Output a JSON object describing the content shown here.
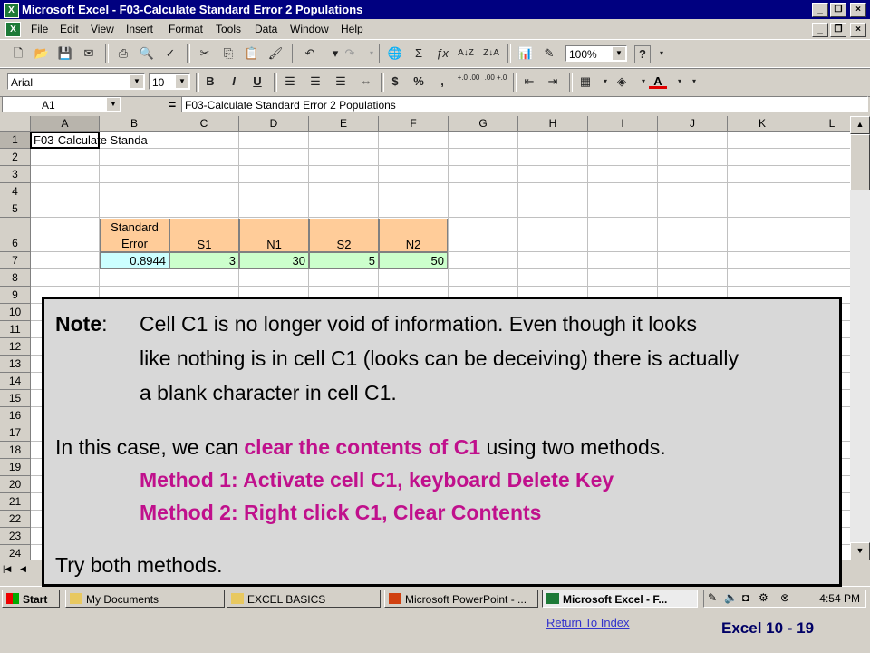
{
  "window": {
    "title": "Microsoft Excel - F03-Calculate Standard Error 2 Populations"
  },
  "menu": [
    "File",
    "Edit",
    "View",
    "Insert",
    "Format",
    "Tools",
    "Data",
    "Window",
    "Help"
  ],
  "toolbar": {
    "zoom": "100%",
    "help_icon": "?"
  },
  "format_toolbar": {
    "font": "Arial",
    "size": "10",
    "bold": "B",
    "italic": "I",
    "underline": "U",
    "currency": "$",
    "percent": "%",
    "comma": ",",
    "inc_decimal": "+.0 .00",
    "dec_decimal": ".00 +.0"
  },
  "formula_bar": {
    "name_box": "A1",
    "equals": "=",
    "content": "F03-Calculate Standard Error 2 Populations"
  },
  "columns": [
    "A",
    "B",
    "C",
    "D",
    "E",
    "F",
    "G",
    "H",
    "I",
    "J",
    "K",
    "L"
  ],
  "rows": [
    "1",
    "2",
    "3",
    "4",
    "5",
    "6",
    "7",
    "8",
    "9",
    "10",
    "11",
    "12",
    "13",
    "14",
    "15",
    "16",
    "17",
    "18",
    "19",
    "20",
    "21",
    "22",
    "23",
    "24"
  ],
  "cells": {
    "a1": "F03-Calculate Standa",
    "b6_line1": "Standard",
    "b6_line2": "Error",
    "c6": "S1",
    "d6": "N1",
    "e6": "S2",
    "f6": "N2",
    "b7": "0.8944",
    "c7": "3",
    "d7": "30",
    "e7": "5",
    "f7": "50"
  },
  "taskbar": {
    "start": "Start",
    "items": [
      "My Documents",
      "EXCEL BASICS",
      "Microsoft PowerPoint - ...",
      "Microsoft Excel - F..."
    ],
    "clock": "4:54 PM"
  },
  "note": {
    "label": "Note",
    "colon": ":",
    "line1": "Cell C1 is no longer void of information.  Even though it looks",
    "line2": "like nothing is in cell C1 (looks can be deceiving) there is actually",
    "line3": "a blank character in cell C1.",
    "p2_pre": "In this case, we can ",
    "p2_highlight": "clear the contents of C1",
    "p2_post": " using two methods.",
    "method1": "Method 1: Activate cell C1, keyboard Delete Key",
    "method2": "Method 2: Right click C1, Clear Contents",
    "closing": "Try both methods."
  },
  "footer": {
    "link": "Return To Index",
    "slide": "Excel 10 -  19"
  },
  "colors": {
    "titlebar": "#000080",
    "header_fill": "#ffcc99",
    "value_fill_blue": "#ccffff",
    "value_fill_green": "#ccffcc",
    "highlight": "#c0108c"
  }
}
